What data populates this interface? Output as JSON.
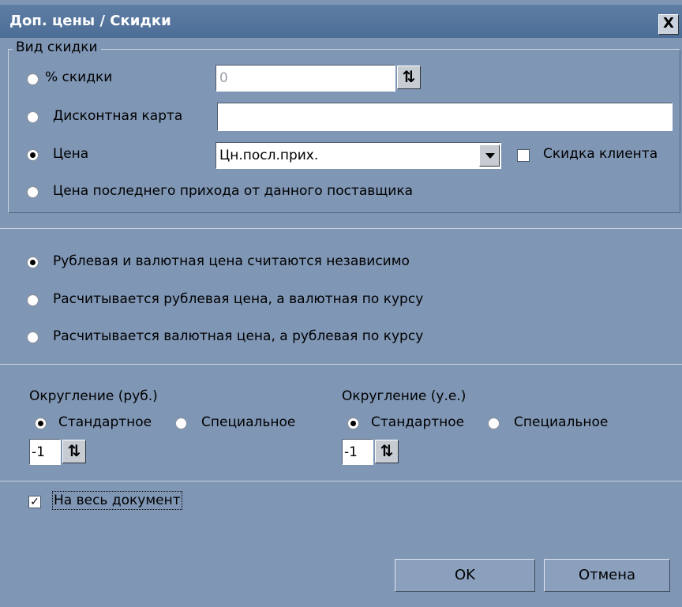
{
  "window": {
    "title": "Доп. цены / Скидки",
    "close_glyph": "X"
  },
  "discount_type": {
    "legend": "Вид скидки",
    "percent_label": "% скидки",
    "percent_value": "0",
    "card_label": "Дисконтная карта",
    "card_value": "",
    "price_label": "Цена",
    "price_value": "Цн.посл.прих.",
    "client_discount_label": "Скидка клиента",
    "client_discount_checked": false,
    "last_supplier_label": "Цена последнего прихода от данного поставщика",
    "selected": "price"
  },
  "calc_mode": {
    "options": [
      "Рублевая и валютная цена считаются независимо",
      "Расчитывается рублевая цена, а валютная по курсу",
      "Расчитывается валютная цена, а рублевая по курсу"
    ],
    "selected_index": 0
  },
  "rounding": {
    "rub": {
      "label": "Округление (руб.)",
      "standard": "Стандартное",
      "special": "Специальное",
      "value": "-1"
    },
    "ue": {
      "label": "Округление (у.е.)",
      "standard": "Стандартное",
      "special": "Специальное",
      "value": "-1"
    }
  },
  "whole_document": {
    "label": "На весь документ",
    "checked": true
  },
  "buttons": {
    "ok": "OK",
    "cancel": "Отмена"
  },
  "icons": {
    "spin": "spin-updown-icon",
    "dropdown": "chevron-down-icon",
    "check": "checkmark-icon"
  },
  "colors": {
    "background": "#7f96b5",
    "titlebar": "#5a789f"
  }
}
